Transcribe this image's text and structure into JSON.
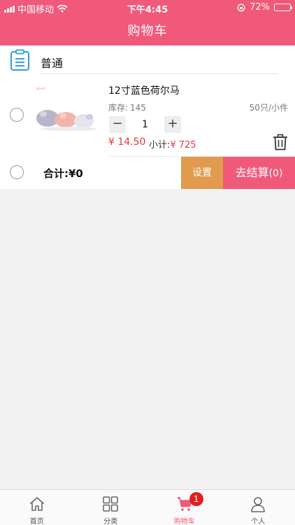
{
  "status_bar": {
    "carrier": "中国移动",
    "time": "下午4:45",
    "battery": "72%",
    "battery_level": 0.72
  },
  "header": {
    "title": "购物车"
  },
  "cart": {
    "group_name": "普通",
    "items": [
      {
        "name": "12寸蓝色荷尔马",
        "stock_label": "库存:",
        "stock": "145",
        "pack": "50只/小件",
        "quantity": "1",
        "minus": "−",
        "plus": "+",
        "price": "¥ 14.50",
        "subtotal_label": "小计:",
        "subtotal": "¥ 725",
        "checked": false
      }
    ]
  },
  "summary": {
    "total_label": "合计:",
    "total_value": "¥0",
    "settings_label": "设置",
    "checkout_label": "去结算",
    "checkout_count": "(0)"
  },
  "tabbar": {
    "tabs": [
      {
        "label": "首页",
        "icon": "home-icon"
      },
      {
        "label": "分类",
        "icon": "grid-icon"
      },
      {
        "label": "购物车",
        "icon": "cart-icon",
        "badge": "1",
        "active": true
      },
      {
        "label": "个人",
        "icon": "user-icon"
      }
    ]
  },
  "colors": {
    "brand": "#f0597a",
    "settings": "#e09b4f",
    "price": "#e4393c",
    "icon_blue": "#3ba1e0"
  }
}
